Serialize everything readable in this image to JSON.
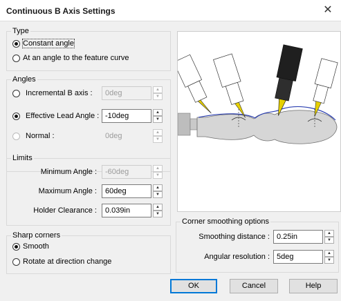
{
  "window": {
    "title": "Continuous B Axis Settings",
    "close_glyph": "✕"
  },
  "type_group": {
    "label": "Type",
    "options": [
      "Constant angle",
      "At an angle to the feature curve"
    ],
    "selected": 0
  },
  "angles_group": {
    "label": "Angles",
    "incremental": {
      "label": "Incremental B axis :",
      "value": "0deg",
      "enabled": false
    },
    "effective": {
      "label": "Effective Lead Angle :",
      "value": "-10deg",
      "enabled": true
    },
    "normal": {
      "label": "Normal :",
      "value": "0deg",
      "enabled": false
    }
  },
  "limits_group": {
    "label": "Limits",
    "min_label": "Minimum Angle :",
    "min_value": "-60deg",
    "max_label": "Maximum Angle :",
    "max_value": "60deg",
    "holder_label": "Holder Clearance :",
    "holder_value": "0.039in"
  },
  "sharp_group": {
    "label": "Sharp corners",
    "options": [
      "Smooth",
      "Rotate at direction change"
    ],
    "selected": 0
  },
  "corner_group": {
    "label": "Corner smoothing options",
    "distance_label": "Smoothing distance :",
    "distance_value": "0.25in",
    "resolution_label": "Angular resolution :",
    "resolution_value": "5deg"
  },
  "buttons": {
    "ok": "OK",
    "cancel": "Cancel",
    "help": "Help"
  },
  "colors": {
    "accent": "#0078d7",
    "curve": "#2b3fb0"
  }
}
